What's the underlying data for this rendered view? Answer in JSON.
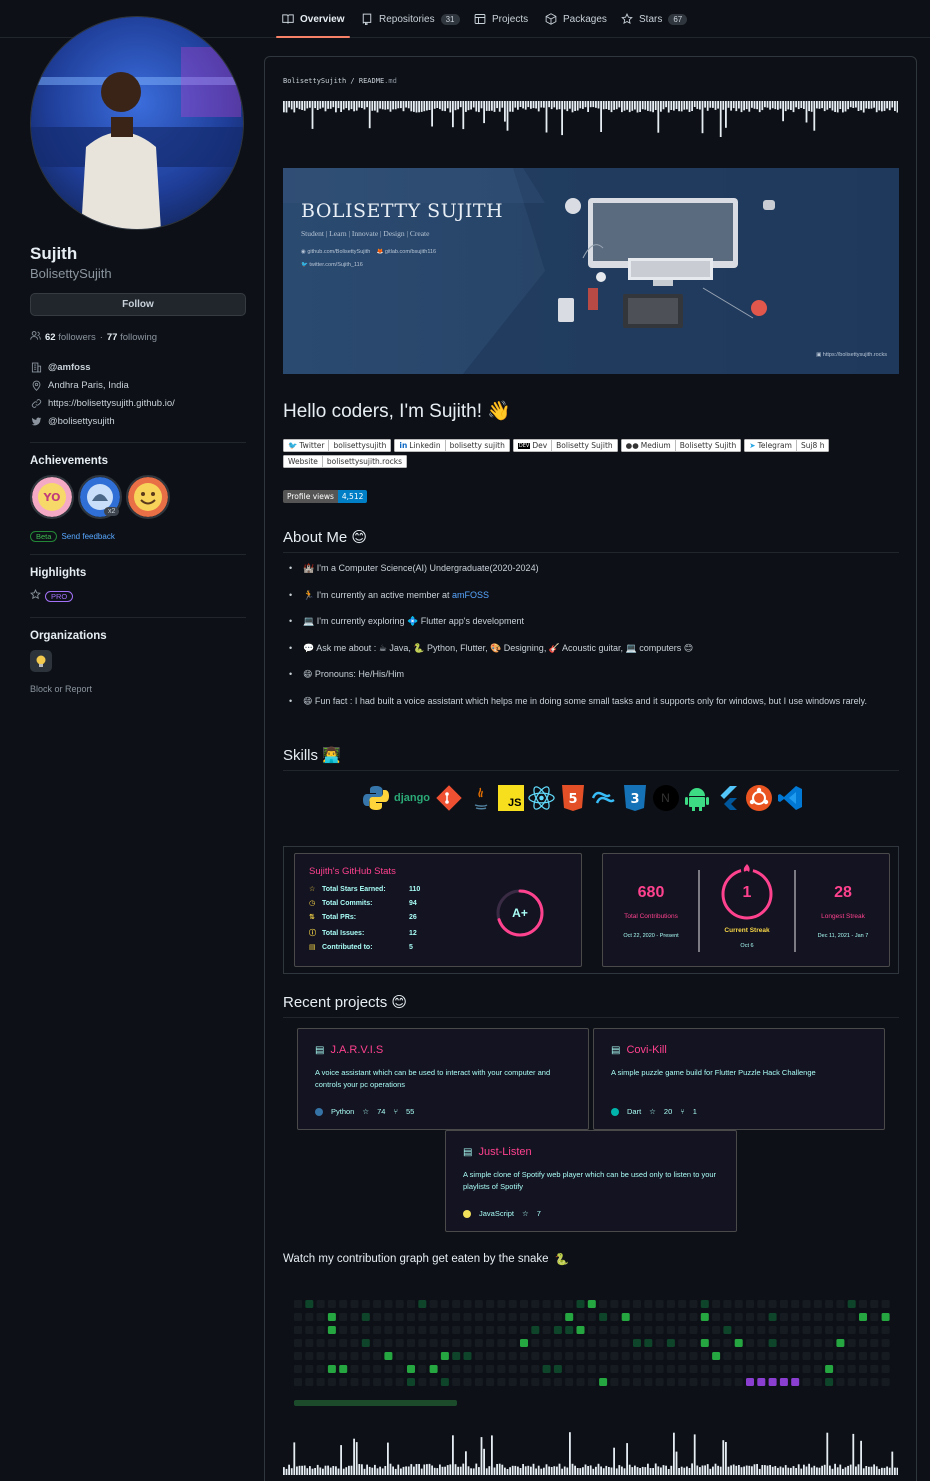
{
  "nav": {
    "tabs": [
      {
        "label": "Overview",
        "count": null
      },
      {
        "label": "Repositories",
        "count": "31"
      },
      {
        "label": "Projects",
        "count": null
      },
      {
        "label": "Packages",
        "count": null
      },
      {
        "label": "Stars",
        "count": "67"
      }
    ]
  },
  "profile": {
    "name": "Sujith",
    "login": "BolisettySujith",
    "follow_label": "Follow",
    "followers_count": "62",
    "followers_label": "followers",
    "following_count": "77",
    "following_label": "following",
    "company": "@amfoss",
    "location": "Andhra Paris, India",
    "website": "https://bolisettysujith.github.io/",
    "twitter": "@bolisettysujith"
  },
  "achievements": {
    "title": "Achievements",
    "multiplier": "x2",
    "beta_label": "Beta",
    "feedback_label": "Send feedback"
  },
  "highlights": {
    "title": "Highlights",
    "pro_label": "PRO"
  },
  "organizations": {
    "title": "Organizations",
    "block_label": "Block or Report"
  },
  "readme": {
    "path_user": "BolisettySujith",
    "path_sep": " / ",
    "path_file": "README",
    "path_ext": ".md"
  },
  "banner": {
    "title": "BOLISETTY SUJITH",
    "tagline": "Student | Learn | Innovate | Design | Create",
    "link_github": "github.com/BolisettySujith",
    "link_gitlab": "gitlab.com/bsujith116",
    "link_twitter": "twitter.com/Sujith_116",
    "url": "https://bolisettysujith.rocks"
  },
  "hello": {
    "title": "Hello coders, I'm Sujith!",
    "emoji": "👋"
  },
  "shields": [
    {
      "label": "Twitter",
      "value": "bolisettysujith",
      "icon": "twitter-icon"
    },
    {
      "label": "Linkedin",
      "value": "bolisetty sujith",
      "icon": "linkedin-icon"
    },
    {
      "label": "Dev",
      "value": "Bolisetty Sujith",
      "icon": "dev-icon"
    },
    {
      "label": "Medium",
      "value": "Bolisetty Sujith",
      "icon": "medium-icon"
    },
    {
      "label": "Telegram",
      "value": "Suj8 h",
      "icon": "telegram-icon"
    },
    {
      "label": "Website",
      "value": "bolisettysujith.rocks",
      "icon": ""
    }
  ],
  "profile_views": {
    "label": "Profile views",
    "value": "4,512"
  },
  "about": {
    "title": "About Me",
    "items": [
      {
        "emoji": "🏰",
        "text": "I'm a Computer Science(AI) Undergraduate(2020-2024)",
        "link": ""
      },
      {
        "emoji": "🏃",
        "text": "I'm currently an active member at ",
        "link": "amFOSS"
      },
      {
        "emoji": "💻",
        "text": "I'm currently exploring  ",
        "extra_icon": "💠",
        "text2": "Flutter app's development"
      },
      {
        "emoji": "💬",
        "text": "Ask me about : ☕ Java, 🐍 Python, Flutter, 🎨 Designing, 🎸 Acoustic guitar, 💻 computers 😊"
      },
      {
        "emoji": "😄",
        "text": "Pronouns: He/His/Him"
      },
      {
        "emoji": "😄",
        "text": "Fun fact : I had built a voice assistant which helps me in doing some small tasks and it supports only for windows, but I use windows rarely."
      }
    ]
  },
  "skills": {
    "title": "Skills",
    "icons": [
      "python-icon",
      "django-icon",
      "git-icon",
      "java-icon",
      "javascript-icon",
      "react-icon",
      "html5-icon",
      "tailwind-icon",
      "css3-icon",
      "nextjs-icon",
      "android-icon",
      "flutter-icon",
      "ubuntu-icon",
      "vscode-icon"
    ],
    "django_text": "django",
    "js_text": "JS",
    "html_text": "5",
    "css_text": "3",
    "next_text": "N"
  },
  "github_stats": {
    "title": "Sujith's GitHub Stats",
    "rows": [
      {
        "label": "Total Stars Earned:",
        "value": "110"
      },
      {
        "label": "Total Commits:",
        "value": "94"
      },
      {
        "label": "Total PRs:",
        "value": "26"
      },
      {
        "label": "Total Issues:",
        "value": "12"
      },
      {
        "label": "Contributed to:",
        "value": "5"
      }
    ],
    "grade": "A+",
    "grade_progress": 0.7
  },
  "streak": {
    "total": "680",
    "total_label": "Total Contributions",
    "total_range": "Oct 22, 2020 - Present",
    "current": "1",
    "current_label": "Current Streak",
    "current_date": "Oct 6",
    "longest": "28",
    "longest_label": "Longest Streak",
    "longest_range": "Dec 11, 2021 - Jan 7"
  },
  "recent": {
    "title": "Recent projects",
    "repos": [
      {
        "name": "J.A.R.V.I.S",
        "desc": "A voice assistant which can be used to interact with your computer and controls your pc operations",
        "lang": "Python",
        "lang_color": "#3572A5",
        "stars": "74",
        "forks": "55"
      },
      {
        "name": "Covi-Kill",
        "desc": "A simple puzzle game build for Flutter Puzzle Hack Challenge",
        "lang": "Dart",
        "lang_color": "#00B4AB",
        "stars": "20",
        "forks": "1"
      },
      {
        "name": "Just-Listen",
        "desc": "A simple clone of Spotify web player which can be used only to listen to your playlists of Spotify",
        "lang": "JavaScript",
        "lang_color": "#f1e05a",
        "stars": "7",
        "forks": ""
      }
    ]
  },
  "snake": {
    "title": "Watch my contribution graph get eaten by the snake",
    "emoji": "🐍"
  },
  "colors": {
    "bg": "#0d1117",
    "border": "#30363d",
    "accent": "#f78166",
    "link": "#58a6ff",
    "card_title": "#fe428e",
    "card_text": "#a9fef7",
    "card_icon": "#f8d847",
    "card_bg": "#141321"
  }
}
